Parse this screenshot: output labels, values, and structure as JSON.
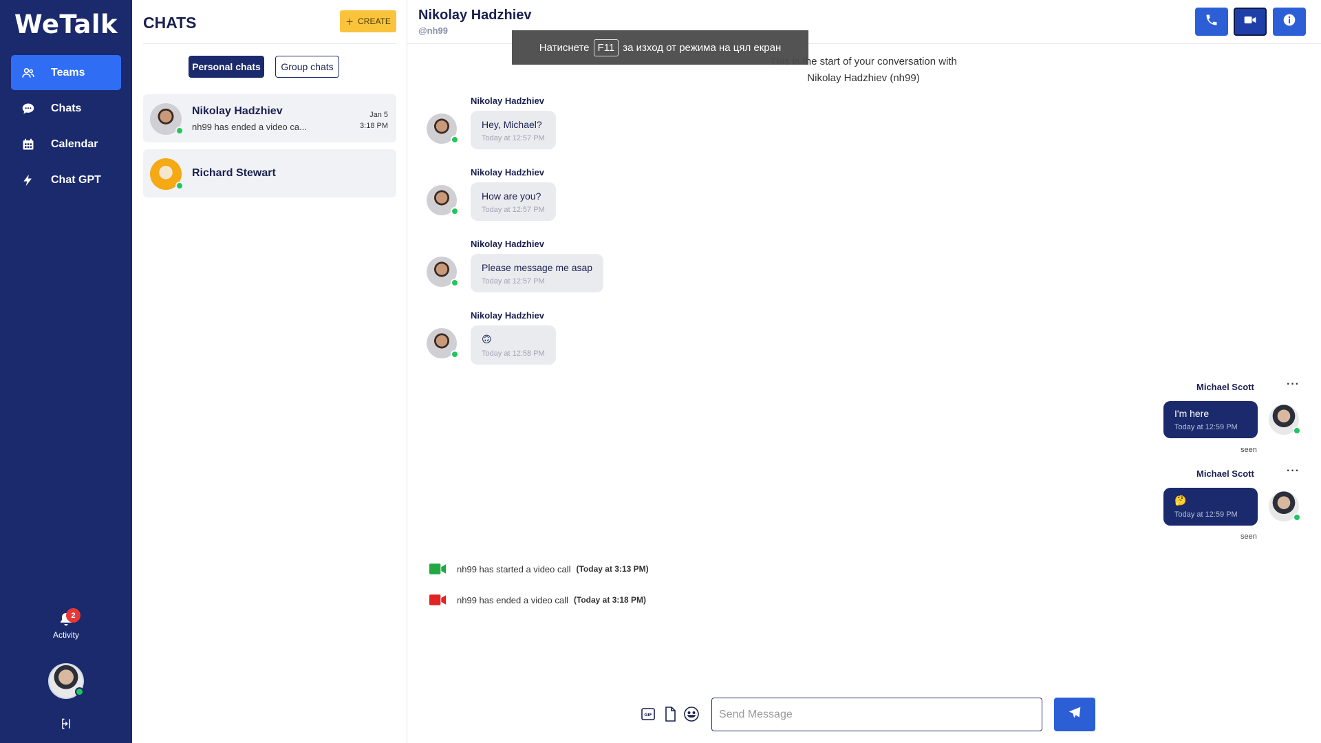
{
  "app": {
    "logo": "WeTalk"
  },
  "nav": {
    "items": [
      {
        "label": "Teams",
        "icon": "users-icon",
        "active": true
      },
      {
        "label": "Chats",
        "icon": "chat-bubble-icon",
        "active": false
      },
      {
        "label": "Calendar",
        "icon": "calendar-icon",
        "active": false
      },
      {
        "label": "Chat GPT",
        "icon": "lightning-icon",
        "active": false
      }
    ],
    "activity": {
      "label": "Activity",
      "badge": "2"
    }
  },
  "list": {
    "title": "CHATS",
    "create_label": "CREATE",
    "tabs": [
      "Personal chats",
      "Group chats"
    ],
    "chats": [
      {
        "name": "Nikolay Hadzhiev",
        "preview": "nh99 has ended a video ca...",
        "date": "Jan 5",
        "time": "3:18 PM"
      },
      {
        "name": "Richard Stewart",
        "preview": "",
        "date": "",
        "time": ""
      }
    ]
  },
  "conversation": {
    "name": "Nikolay Hadzhiev",
    "handle": "@nh99",
    "start_text_line1": "This is the start of your conversation with",
    "start_text_line2": "Nikolay Hadzhiev (nh99)",
    "fullscreen_toast": {
      "before": "Натиснете",
      "key": "F11",
      "after": "за изход от режима на цял екран"
    },
    "incoming": [
      {
        "sender": "Nikolay Hadzhiev",
        "text": "Hey, Michael?",
        "time": "Today at 12:57 PM"
      },
      {
        "sender": "Nikolay Hadzhiev",
        "text": "How are you?",
        "time": "Today at 12:57 PM"
      },
      {
        "sender": "Nikolay Hadzhiev",
        "text": "Please message me asap",
        "time": "Today at 12:57 PM"
      },
      {
        "sender": "Nikolay Hadzhiev",
        "text": "🙃",
        "time": "Today at 12:58 PM"
      }
    ],
    "outgoing": [
      {
        "sender": "Michael Scott",
        "text": "I'm here",
        "time": "Today at 12:59 PM",
        "status": "seen"
      },
      {
        "sender": "Michael Scott",
        "text": "🤔",
        "time": "Today at 12:59 PM",
        "status": "seen"
      }
    ],
    "calls": [
      {
        "text": "nh99 has started a video call",
        "when": "(Today at 3:13 PM)",
        "color": "#22a843"
      },
      {
        "text": "nh99 has ended a video call",
        "when": "(Today at 3:18 PM)",
        "color": "#e02424"
      }
    ],
    "composer": {
      "placeholder": "Send Message"
    }
  },
  "colors": {
    "nav_bg": "#1a2a6c",
    "accent": "#2f6df5",
    "create": "#f9c33b",
    "online": "#22c55e"
  }
}
